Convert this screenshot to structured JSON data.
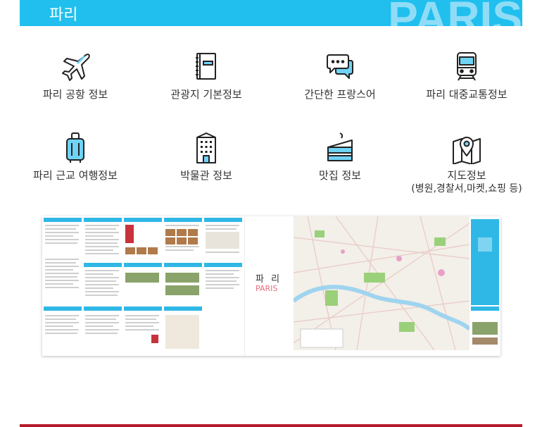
{
  "header": {
    "title": "파리",
    "watermark": "PARIS"
  },
  "features": [
    {
      "label": "파리 공항 정보",
      "icon": "airplane-icon"
    },
    {
      "label": "관광지 기본정보",
      "icon": "notebook-icon"
    },
    {
      "label": "간단한 프랑스어",
      "icon": "speech-bubbles-icon"
    },
    {
      "label": "파리 대중교통정보",
      "icon": "train-icon"
    },
    {
      "label": "파리 근교 여행정보",
      "icon": "suitcase-icon"
    },
    {
      "label": "박물관 정보",
      "icon": "museum-building-icon"
    },
    {
      "label": "맛집 정보",
      "icon": "cake-icon"
    },
    {
      "label": "지도정보",
      "sub": "(병원,경찰서,마켓,쇼핑 등)",
      "icon": "map-pin-icon"
    }
  ],
  "brochure": {
    "title_ko": "파 리",
    "title_en": "PARIS"
  },
  "colors": {
    "accent": "#20bfee",
    "watermark": "#8fdcf7",
    "icon": "#222222",
    "icon_fill": "#6fd3f5",
    "bottom": "#b71b2e"
  }
}
